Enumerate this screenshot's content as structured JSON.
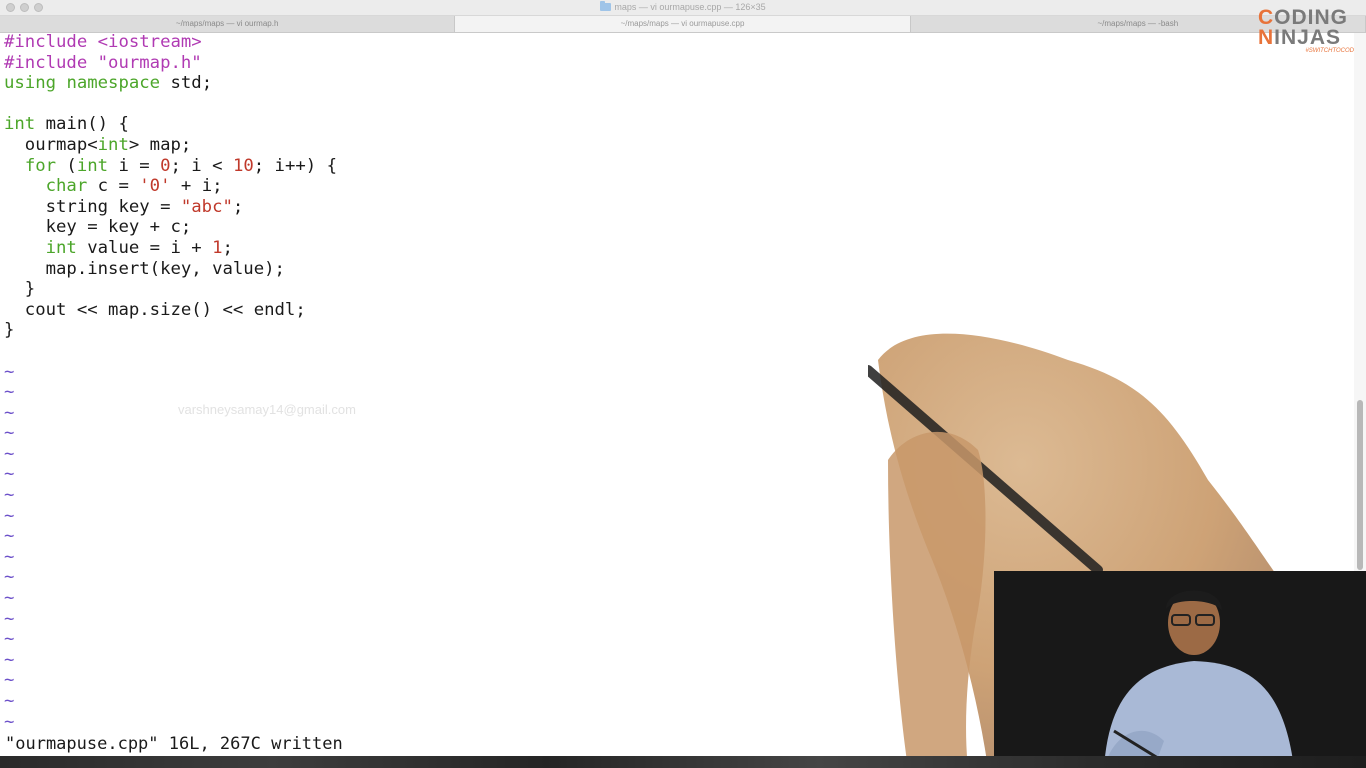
{
  "window": {
    "title": "maps — vi ourmapuse.cpp — 126×35"
  },
  "tabs": [
    {
      "label": "~/maps/maps — vi ourmap.h"
    },
    {
      "label": "~/maps/maps — vi ourmapuse.cpp"
    },
    {
      "label": "~/maps/maps — -bash"
    }
  ],
  "editor": {
    "lines": [
      "#include <iostream>",
      "#include \"ourmap.h\"",
      "using namespace std;",
      "",
      "int main() {",
      "  ourmap<int> map;",
      "  for (int i = 0; i < 10; i++) {",
      "    char c = '0' + i;",
      "    string key = \"abc\";",
      "    key = key + c;",
      "    int value = i + 1;",
      "    map.insert(key, value);",
      "  }",
      "  cout << map.size() << endl;",
      "}"
    ],
    "tilde": "~",
    "status": "\"ourmapuse.cpp\" 16L, 267C written"
  },
  "watermark": "varshneysamay14@gmail.com",
  "logo": {
    "line1_first": "C",
    "line1_rest": "ODING",
    "line2_first": "N",
    "line2_rest": "INJAS",
    "tagline": "#SWITCHTOCODE"
  },
  "colors": {
    "preprocessor": "#b03ab3",
    "keyword": "#4ca62a",
    "string": "#c0392b",
    "tilde": "#6b4fc9",
    "logo_accent": "#e8733a"
  }
}
